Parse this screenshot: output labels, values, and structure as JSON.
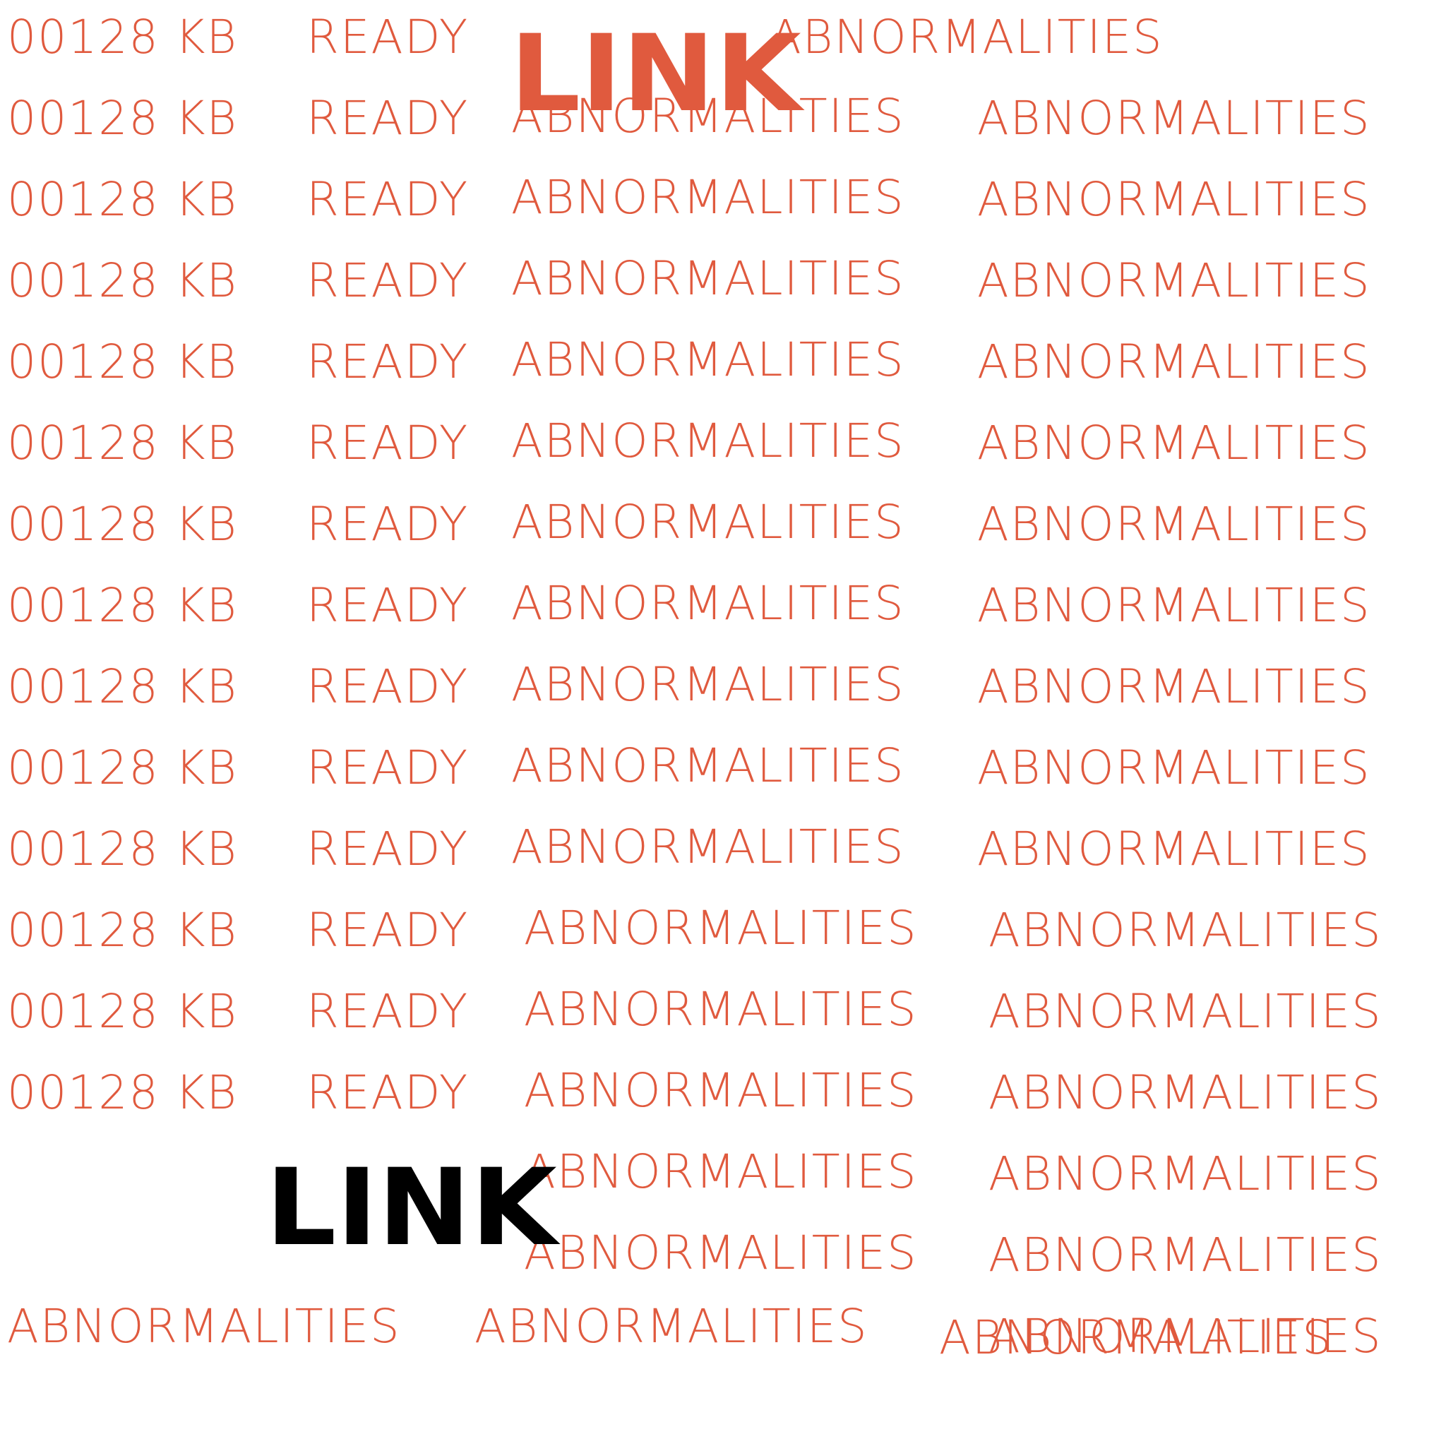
{
  "colors": {
    "accent": "#e05a3e",
    "dark": "#000000",
    "background": "#ffffff"
  },
  "texts": {
    "kb": "00128 KB",
    "ready": "READY",
    "abnormalities": "ABNORMALITIES",
    "link": "LINK"
  }
}
